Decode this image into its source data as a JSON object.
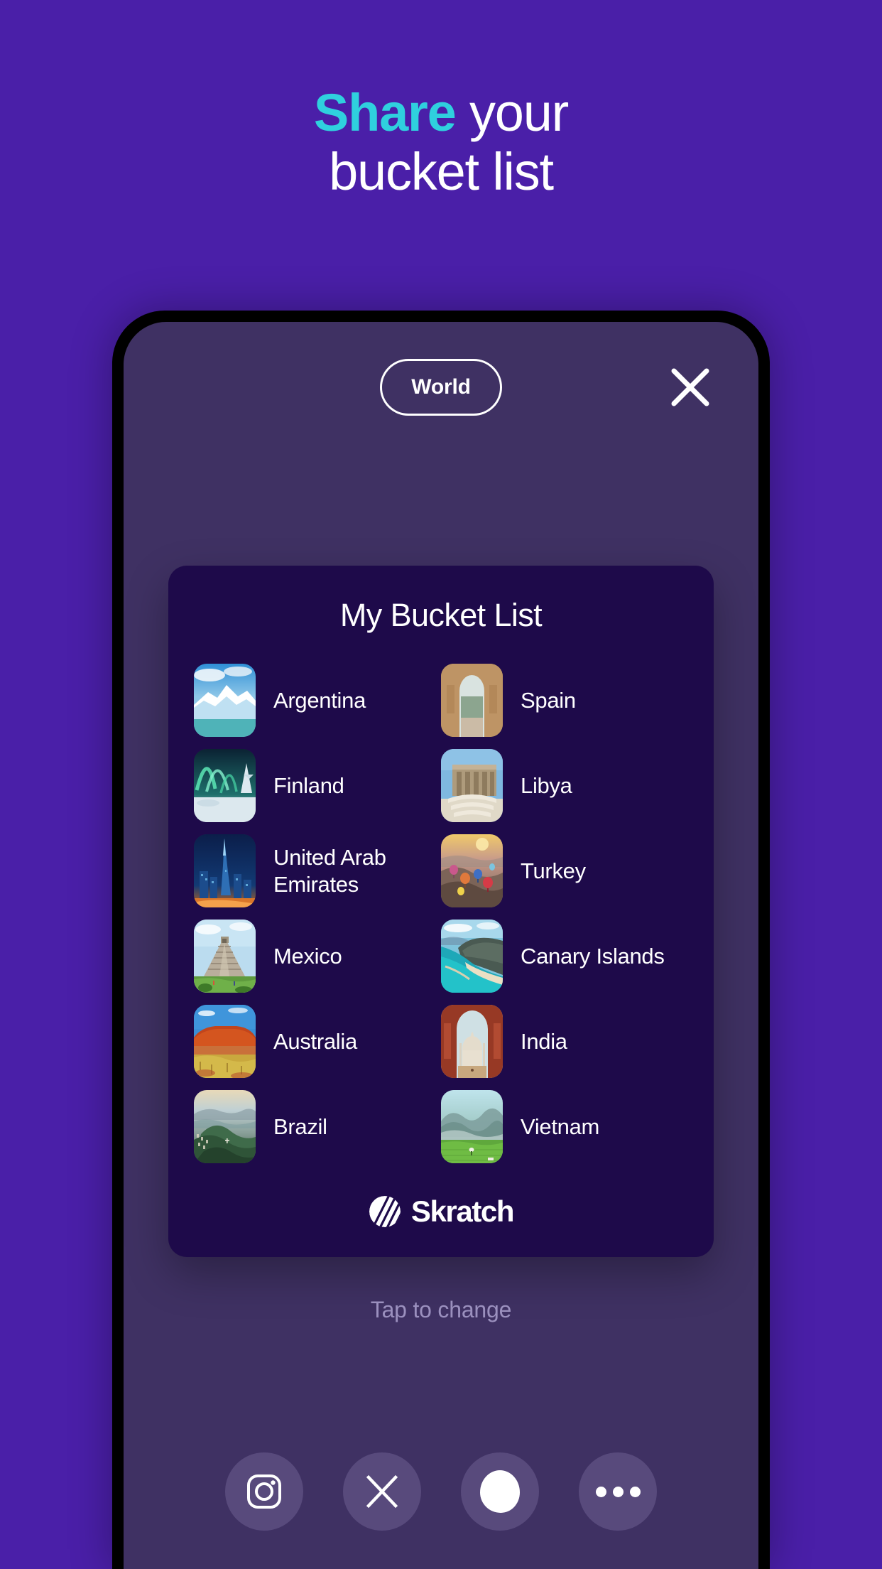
{
  "headline": {
    "accent_word": "Share",
    "rest_line1": " your",
    "line2": "bucket list",
    "accent_color": "#2FD0DE",
    "text_color": "#FFFFFF"
  },
  "theme": {
    "page_background": "#4A1FA8",
    "phone_screen_background": "#3F3163",
    "card_background": "#1E0A4A",
    "share_button_background": "#584A7C",
    "muted_text": "#9B90BE"
  },
  "app": {
    "topbar": {
      "region_pill_label": "World",
      "close_label": "close-icon"
    },
    "card": {
      "title": "My Bucket List",
      "destinations": [
        {
          "name": "Argentina",
          "image": "glacier-iceberg-photo",
          "column": "left"
        },
        {
          "name": "Spain",
          "image": "alhambra-archway-photo",
          "column": "right"
        },
        {
          "name": "Finland",
          "image": "aurora-snow-forest-photo",
          "column": "left"
        },
        {
          "name": "Libya",
          "image": "roman-ruins-photo",
          "column": "right"
        },
        {
          "name": "United Arab Emirates",
          "image": "dubai-skyline-night-photo",
          "column": "left"
        },
        {
          "name": "Turkey",
          "image": "cappadocia-balloons-photo",
          "column": "right"
        },
        {
          "name": "Mexico",
          "image": "chichen-itza-pyramid-photo",
          "column": "left"
        },
        {
          "name": "Canary Islands",
          "image": "coastal-beach-cliffs-photo",
          "column": "right"
        },
        {
          "name": "Australia",
          "image": "uluru-outback-photo",
          "column": "left"
        },
        {
          "name": "India",
          "image": "taj-mahal-arch-photo",
          "column": "right"
        },
        {
          "name": "Brazil",
          "image": "rio-sugarloaf-photo",
          "column": "left"
        },
        {
          "name": "Vietnam",
          "image": "rice-fields-photo",
          "column": "right"
        }
      ],
      "brand_name": "Skratch"
    },
    "tap_hint": "Tap to change",
    "share_buttons": [
      {
        "label": "Instagram",
        "icon": "instagram-icon"
      },
      {
        "label": "X",
        "icon": "x-twitter-icon"
      },
      {
        "label": "Messages",
        "icon": "messages-blob-icon"
      },
      {
        "label": "More",
        "icon": "more-dots-icon"
      }
    ]
  }
}
